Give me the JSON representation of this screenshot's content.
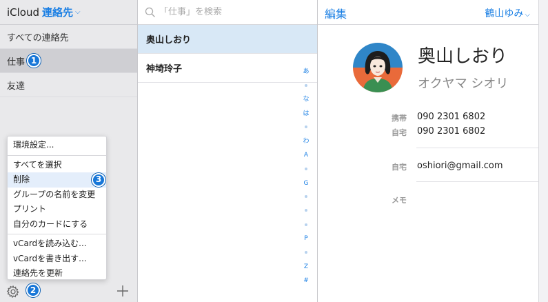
{
  "sidebar": {
    "app_name": "iCloud",
    "current": "連絡先",
    "groups": [
      {
        "label": "すべての連絡先"
      },
      {
        "label": "仕事"
      },
      {
        "label": "友達"
      }
    ],
    "badges": [
      "1",
      "2",
      "3"
    ]
  },
  "menu": {
    "items": [
      "環境設定...",
      "すべてを選択",
      "削除",
      "グループの名前を変更",
      "プリント",
      "自分のカードにする",
      "vCardを読み込む...",
      "vCardを書き出す...",
      "連絡先を更新"
    ]
  },
  "search": {
    "placeholder": "「仕事」を検索"
  },
  "contacts": [
    {
      "name": "奥山しおり"
    },
    {
      "name": "神埼玲子"
    }
  ],
  "index_letters": [
    "あ",
    "•",
    "な",
    "は",
    "•",
    "わ",
    "A",
    "•",
    "G",
    "•",
    "•",
    "•",
    "P",
    "•",
    "Z",
    "#"
  ],
  "detail": {
    "edit_label": "編集",
    "user": "鶴山ゆみ",
    "name": "奥山しおり",
    "name_kana": "オクヤマ シオリ",
    "fields": {
      "mobile_label": "携帯",
      "mobile_value": "090 2301 6802",
      "home_label": "自宅",
      "home_value": "090 2301 6802",
      "email_label": "自宅",
      "email_value": "oshiori@gmail.com",
      "memo_label": "メモ"
    }
  },
  "colors": {
    "accent": "#1a7fe4",
    "badge": "#1877d8",
    "selected_row": "#d8e8f6"
  }
}
